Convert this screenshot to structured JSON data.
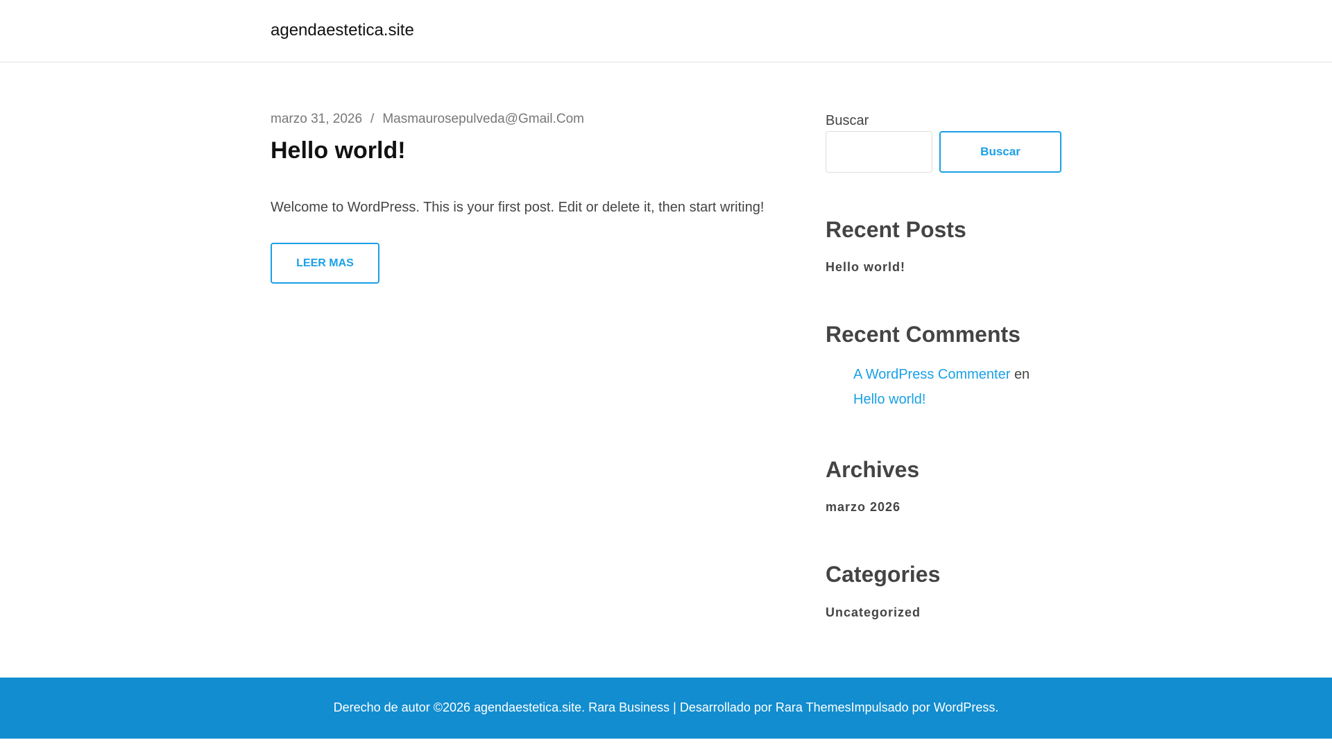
{
  "header": {
    "site_title": "agendaestetica.site"
  },
  "post": {
    "date": "marzo 31, 2026",
    "separator": "/",
    "author": "Masmaurosepulveda@Gmail.Com",
    "title": "Hello world!",
    "excerpt": "Welcome to WordPress. This is your first post. Edit or delete it, then start writing!",
    "read_more": "LEER MAS"
  },
  "sidebar": {
    "search": {
      "label": "Buscar",
      "value": "",
      "button": "Buscar"
    },
    "recent_posts": {
      "title": "Recent Posts",
      "items": [
        "Hello world!"
      ]
    },
    "recent_comments": {
      "title": "Recent Comments",
      "author": "A WordPress Commenter",
      "connector": "en",
      "post": "Hello world!"
    },
    "archives": {
      "title": "Archives",
      "items": [
        "marzo 2026"
      ]
    },
    "categories": {
      "title": "Categories",
      "items": [
        "Uncategorized"
      ]
    }
  },
  "footer": {
    "text": "Derecho de autor ©2026 agendaestetica.site. Rara Business | Desarrollado por Rara ThemesImpulsado por WordPress."
  },
  "colors": {
    "accent": "#1aa0e6",
    "footer_bg": "#128dcf"
  }
}
